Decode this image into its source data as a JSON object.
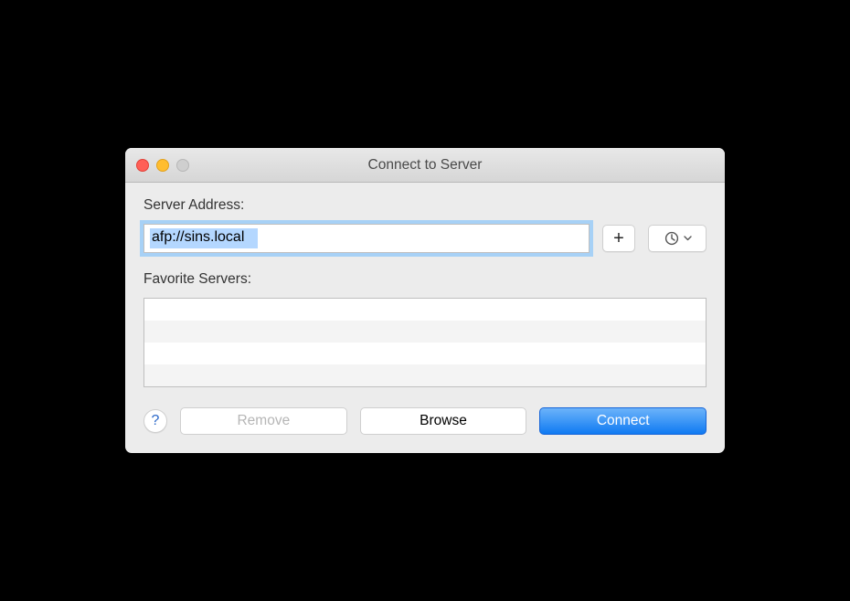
{
  "window": {
    "title": "Connect to Server"
  },
  "labels": {
    "server_address": "Server Address:",
    "favorite_servers": "Favorite Servers:"
  },
  "input": {
    "server_address_value": "afp://sins.local"
  },
  "buttons": {
    "add": "+",
    "help": "?",
    "remove": "Remove",
    "browse": "Browse",
    "connect": "Connect"
  },
  "favorites": []
}
